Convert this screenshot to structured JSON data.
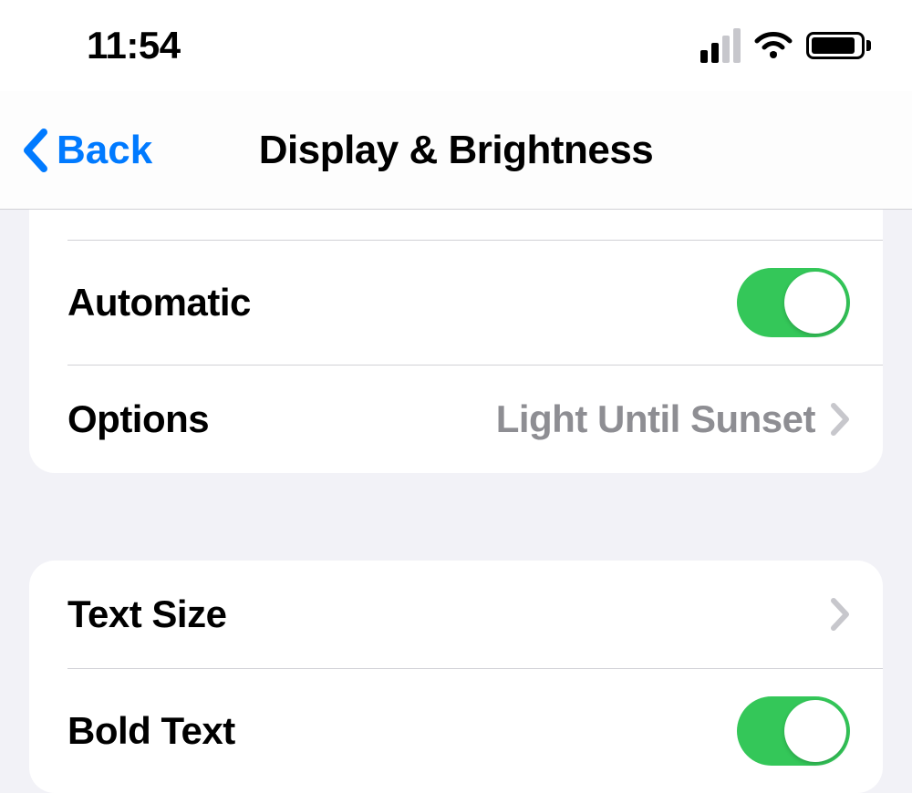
{
  "status": {
    "time": "11:54"
  },
  "nav": {
    "back_label": "Back",
    "title": "Display & Brightness"
  },
  "section1": {
    "automatic": {
      "label": "Automatic",
      "enabled": true
    },
    "options": {
      "label": "Options",
      "value": "Light Until Sunset"
    }
  },
  "section2": {
    "text_size": {
      "label": "Text Size"
    },
    "bold_text": {
      "label": "Bold Text",
      "enabled": true
    }
  }
}
